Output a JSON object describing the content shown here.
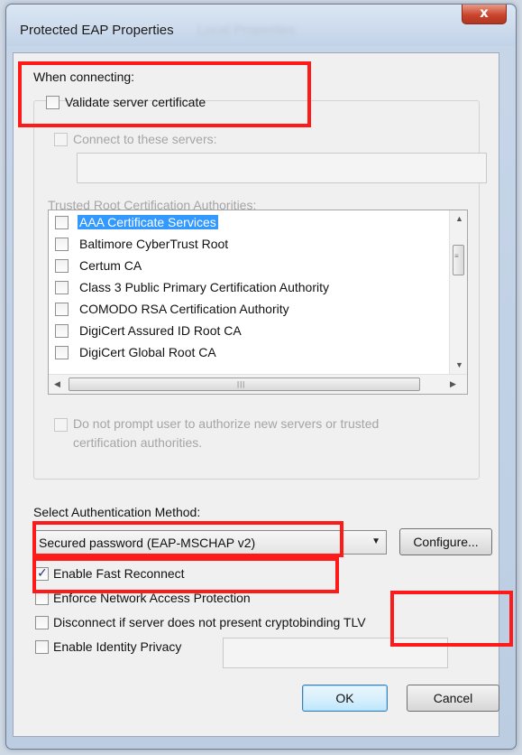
{
  "window": {
    "title": "Protected EAP Properties",
    "close_label": "x"
  },
  "connecting": {
    "heading": "When connecting:",
    "validate_label": "Validate server certificate",
    "validate_checked": false,
    "connect_servers_label": "Connect to these servers:",
    "connect_servers_value": "",
    "trusted_roots_label": "Trusted Root Certification Authorities:",
    "authorities": [
      {
        "label": "AAA Certificate Services",
        "checked": false,
        "selected": true
      },
      {
        "label": "Baltimore CyberTrust Root",
        "checked": false,
        "selected": false
      },
      {
        "label": "Certum CA",
        "checked": false,
        "selected": false
      },
      {
        "label": "Class 3 Public Primary Certification Authority",
        "checked": false,
        "selected": false
      },
      {
        "label": "COMODO RSA Certification Authority",
        "checked": false,
        "selected": false
      },
      {
        "label": "DigiCert Assured ID Root CA",
        "checked": false,
        "selected": false
      },
      {
        "label": "DigiCert Global Root CA",
        "checked": false,
        "selected": false
      }
    ],
    "no_prompt_line1": "Do not prompt user to authorize new servers or trusted",
    "no_prompt_line2": "certification authorities."
  },
  "auth": {
    "heading": "Select Authentication Method:",
    "method_value": "Secured password (EAP-MSCHAP v2)",
    "configure_label": "Configure...",
    "options": [
      {
        "label": "Enable Fast Reconnect",
        "checked": true
      },
      {
        "label": "Enforce Network Access Protection",
        "checked": false
      },
      {
        "label": "Disconnect if server does not present cryptobinding TLV",
        "checked": false
      },
      {
        "label": "Enable Identity Privacy",
        "checked": false
      }
    ],
    "identity_value": ""
  },
  "buttons": {
    "ok_label": "OK",
    "cancel_label": "Cancel"
  },
  "annotation_color": "#ff1a1a"
}
